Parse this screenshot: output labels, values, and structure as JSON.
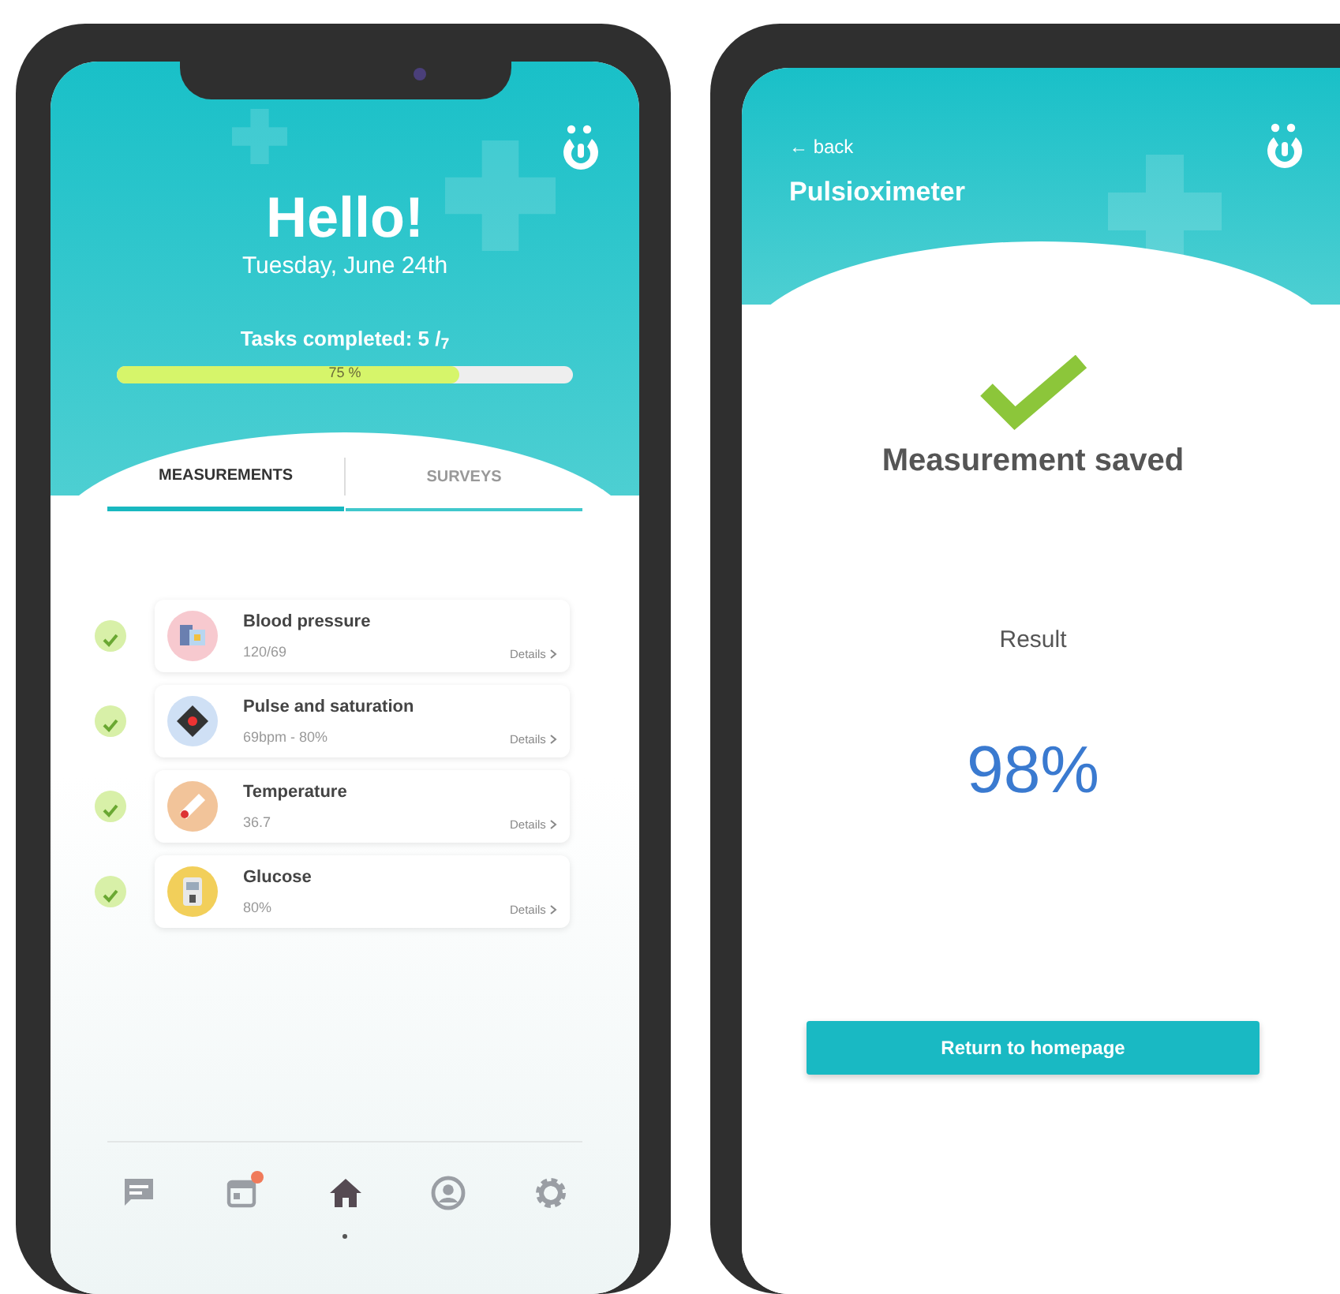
{
  "home": {
    "greeting": "Hello!",
    "date": "Tuesday, June 24th",
    "tasks": {
      "label": "Tasks completed: 5 /$_{7}$",
      "level": 0.75,
      "reading": "75 %"
    },
    "tabs": [
      {
        "label": "MEASUREMENTS",
        "selected": true
      },
      {
        "label": "SURVEYS",
        "selected": false
      }
    ],
    "measurements": [
      {
        "kind": "blood",
        "title": "Blood pressure",
        "value": "120/69",
        "link": "Details",
        "done": true
      },
      {
        "kind": "pulse",
        "title": "Pulse and saturation",
        "value": "69bpm - 80%",
        "link": "Details",
        "done": true
      },
      {
        "kind": "temperature",
        "title": "Temperature",
        "value": "36.7",
        "link": "Details",
        "done": true
      },
      {
        "kind": "glucose",
        "title": "Glucose",
        "value": "80%",
        "link": "Details",
        "done": true
      }
    ],
    "nav": [
      {
        "kind": "chat",
        "selected": false,
        "badge": false
      },
      {
        "kind": "calendar",
        "selected": false,
        "badge": true
      },
      {
        "kind": "home",
        "selected": true,
        "badge": false
      },
      {
        "kind": "profile",
        "selected": false,
        "badge": false
      },
      {
        "kind": "settings",
        "selected": false,
        "badge": false
      }
    ]
  },
  "result_screen": {
    "back": "← back",
    "title": "Pulsioximeter",
    "status": "Measurement saved",
    "result_label": "Result",
    "result_value": "98%",
    "button": "Return to homepage"
  }
}
